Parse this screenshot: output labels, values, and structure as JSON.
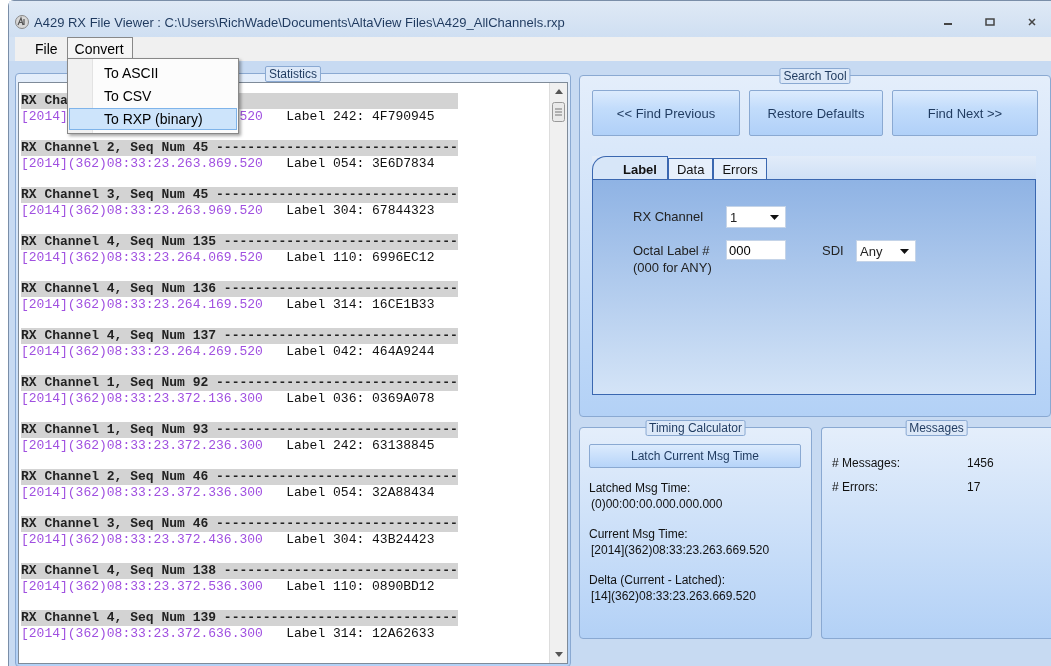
{
  "window": {
    "title": "A429 RX File Viewer : C:\\Users\\RichWade\\Documents\\AltaView Files\\A429_AllChannels.rxp"
  },
  "menu_bar": {
    "items": [
      {
        "label": "File",
        "selected": false
      },
      {
        "label": "Convert",
        "selected": true
      }
    ]
  },
  "convert_menu": {
    "items": [
      {
        "label": "To ASCII",
        "selected": false
      },
      {
        "label": "To CSV",
        "selected": false
      },
      {
        "label": "To RXP (binary)",
        "selected": true
      }
    ]
  },
  "statistics": {
    "title": "Statistics",
    "records": [
      {
        "header": "RX Cha",
        "time": "[2014]",
        "time_end": "520",
        "value": "Label 242: 4F790945"
      },
      {
        "header": "RX Channel 2, Seq Num 45 -------------------------------",
        "time": "[2014](362)08:33:23.263.869.520",
        "value": "Label 054: 3E6D7834"
      },
      {
        "header": "RX Channel 3, Seq Num 45 -------------------------------",
        "time": "[2014](362)08:33:23.263.969.520",
        "value": "Label 304: 67844323"
      },
      {
        "header": "RX Channel 4, Seq Num 135 ------------------------------",
        "time": "[2014](362)08:33:23.264.069.520",
        "value": "Label 110: 6996EC12"
      },
      {
        "header": "RX Channel 4, Seq Num 136 ------------------------------",
        "time": "[2014](362)08:33:23.264.169.520",
        "value": "Label 314: 16CE1B33"
      },
      {
        "header": "RX Channel 4, Seq Num 137 ------------------------------",
        "time": "[2014](362)08:33:23.264.269.520",
        "value": "Label 042: 464A9244"
      },
      {
        "header": "RX Channel 1, Seq Num 92 -------------------------------",
        "time": "[2014](362)08:33:23.372.136.300",
        "value": "Label 036: 0369A078"
      },
      {
        "header": "RX Channel 1, Seq Num 93 -------------------------------",
        "time": "[2014](362)08:33:23.372.236.300",
        "value": "Label 242: 63138845"
      },
      {
        "header": "RX Channel 2, Seq Num 46 -------------------------------",
        "time": "[2014](362)08:33:23.372.336.300",
        "value": "Label 054: 32A88434"
      },
      {
        "header": "RX Channel 3, Seq Num 46 -------------------------------",
        "time": "[2014](362)08:33:23.372.436.300",
        "value": "Label 304: 43B24423"
      },
      {
        "header": "RX Channel 4, Seq Num 138 ------------------------------",
        "time": "[2014](362)08:33:23.372.536.300",
        "value": "Label 110: 0890BD12"
      },
      {
        "header": "RX Channel 4, Seq Num 139 ------------------------------",
        "time": "[2014](362)08:33:23.372.636.300",
        "value": "Label 314: 12A62633"
      }
    ]
  },
  "search_tool": {
    "title": "Search Tool",
    "buttons": [
      "<< Find Previous",
      "Restore Defaults",
      "Find Next >>"
    ],
    "tabs": [
      {
        "label": "Label",
        "selected": true
      },
      {
        "label": "Data",
        "selected": false
      },
      {
        "label": "Errors",
        "selected": false
      }
    ],
    "fields": [
      {
        "label": "RX Channel",
        "kind": "dropdown",
        "value": "1"
      },
      {
        "label": "Octal Label #",
        "note": "(000 for ANY)",
        "kind": "text",
        "value": "000"
      },
      {
        "label": "SDI",
        "kind": "dropdown",
        "value": "Any"
      }
    ]
  },
  "timing_calculator": {
    "title": "Timing Calculator",
    "button": "Latch Current Msg Time",
    "entries": [
      {
        "label": "Latched Msg Time:",
        "value": "(0)00:00:00.000.000.000"
      },
      {
        "label": "Current Msg Time:",
        "value": "[2014](362)08:33:23.263.669.520"
      },
      {
        "label": "Delta (Current - Latched):",
        "value": "[14](362)08:33:23.263.669.520"
      }
    ]
  },
  "messages": {
    "title": "Messages",
    "stats": [
      {
        "label": "# Messages:",
        "value": "1456"
      },
      {
        "label": "# Errors:",
        "value": "17"
      }
    ]
  }
}
